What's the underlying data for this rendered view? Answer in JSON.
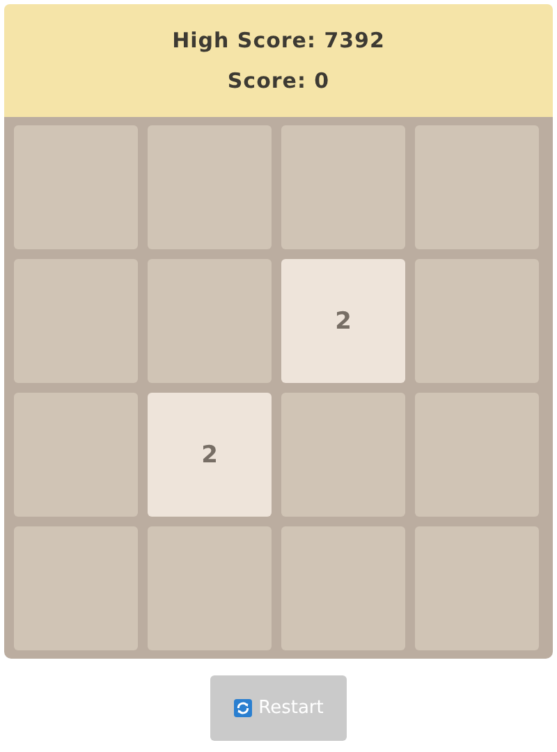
{
  "header": {
    "high_score": "High Score: 7392",
    "score": "Score: 0"
  },
  "board": {
    "rows": [
      [
        {
          "kind": "empty"
        },
        {
          "kind": "empty"
        },
        {
          "kind": "empty"
        },
        {
          "kind": "empty"
        }
      ],
      [
        {
          "kind": "empty"
        },
        {
          "kind": "empty"
        },
        {
          "kind": "tile",
          "value": "2"
        },
        {
          "kind": "empty"
        }
      ],
      [
        {
          "kind": "empty"
        },
        {
          "kind": "tile",
          "value": "2"
        },
        {
          "kind": "empty"
        },
        {
          "kind": "empty"
        }
      ],
      [
        {
          "kind": "empty"
        },
        {
          "kind": "empty"
        },
        {
          "kind": "empty"
        },
        {
          "kind": "empty"
        }
      ]
    ]
  },
  "restart_button": {
    "label": "Restart"
  }
}
